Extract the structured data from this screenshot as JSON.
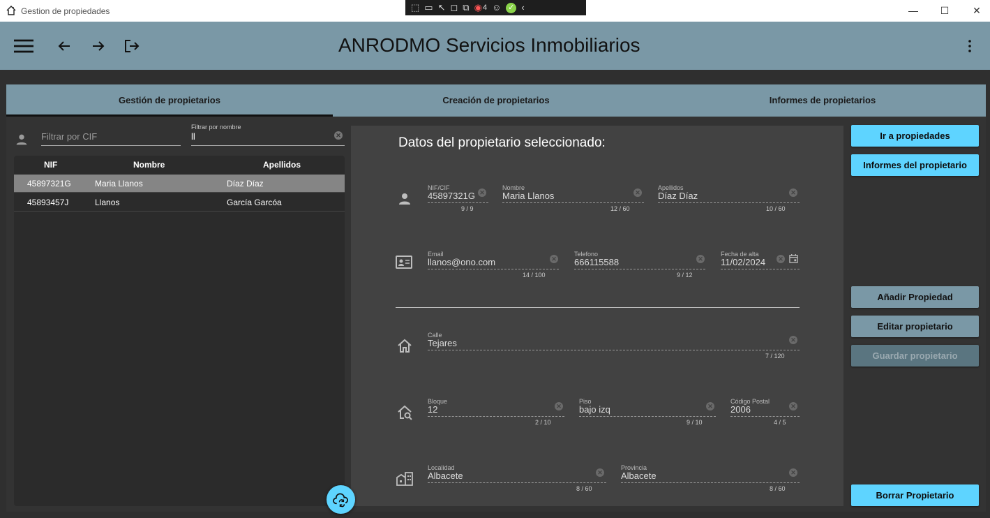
{
  "window": {
    "title": "Gestion de propiedades",
    "debug_count": "4"
  },
  "appbar": {
    "title": "ANRODMO Servicios Inmobiliarios"
  },
  "tabs": [
    {
      "label": "Gestión de propietarios"
    },
    {
      "label": "Creación de propietarios"
    },
    {
      "label": "Informes de propietarios"
    }
  ],
  "filters": {
    "cif_placeholder": "Filtrar por CIF",
    "nombre_label": "Filtrar por nombre",
    "nombre_value": "ll"
  },
  "table": {
    "headers": [
      "NIF",
      "Nombre",
      "Apellidos"
    ],
    "rows": [
      {
        "nif": "45897321G",
        "nombre": "Maria Llanos",
        "apellidos": "Díaz  Díaz"
      },
      {
        "nif": "45893457J",
        "nombre": "Llanos",
        "apellidos": "García Garcóa"
      }
    ]
  },
  "detail": {
    "title": "Datos del propietario seleccionado:",
    "nif": {
      "label": "NIF/CIF",
      "value": "45897321G",
      "count": "9 / 9"
    },
    "nombre": {
      "label": "Nombre",
      "value": "Maria Llanos",
      "count": "12 / 60"
    },
    "apellidos": {
      "label": "Apellidos",
      "value": "Díaz  Díaz",
      "count": "10 / 60"
    },
    "email": {
      "label": "Email",
      "value": "llanos@ono.com",
      "count": "14 / 100"
    },
    "telefono": {
      "label": "Telefono",
      "value": "666115588",
      "count": "9 / 12"
    },
    "fecha": {
      "label": "Fecha de alta",
      "value": "11/02/2024"
    },
    "calle": {
      "label": "Calle",
      "value": "Tejares",
      "count": "7 / 120"
    },
    "bloque": {
      "label": "Bloque",
      "value": "12",
      "count": "2 / 10"
    },
    "piso": {
      "label": "Piso",
      "value": "bajo  izq",
      "count": "9 / 10"
    },
    "cp": {
      "label": "Código Postal",
      "value": "2006",
      "count": "4 / 5"
    },
    "localidad": {
      "label": "Localidad",
      "value": "Albacete",
      "count": "8 / 60"
    },
    "provincia": {
      "label": "Provincia",
      "value": "Albacete",
      "count": "8 / 60"
    }
  },
  "buttons": {
    "ir_propiedades": "Ir a propiedades",
    "informes": "Informes del propietario",
    "anadir": "Añadir Propiedad",
    "editar": "Editar propietario",
    "guardar": "Guardar propietario",
    "borrar": "Borrar Propietario"
  },
  "colors": {
    "accent": "#5ed4ff",
    "appbar": "#7a98a6",
    "panel": "#424242"
  }
}
